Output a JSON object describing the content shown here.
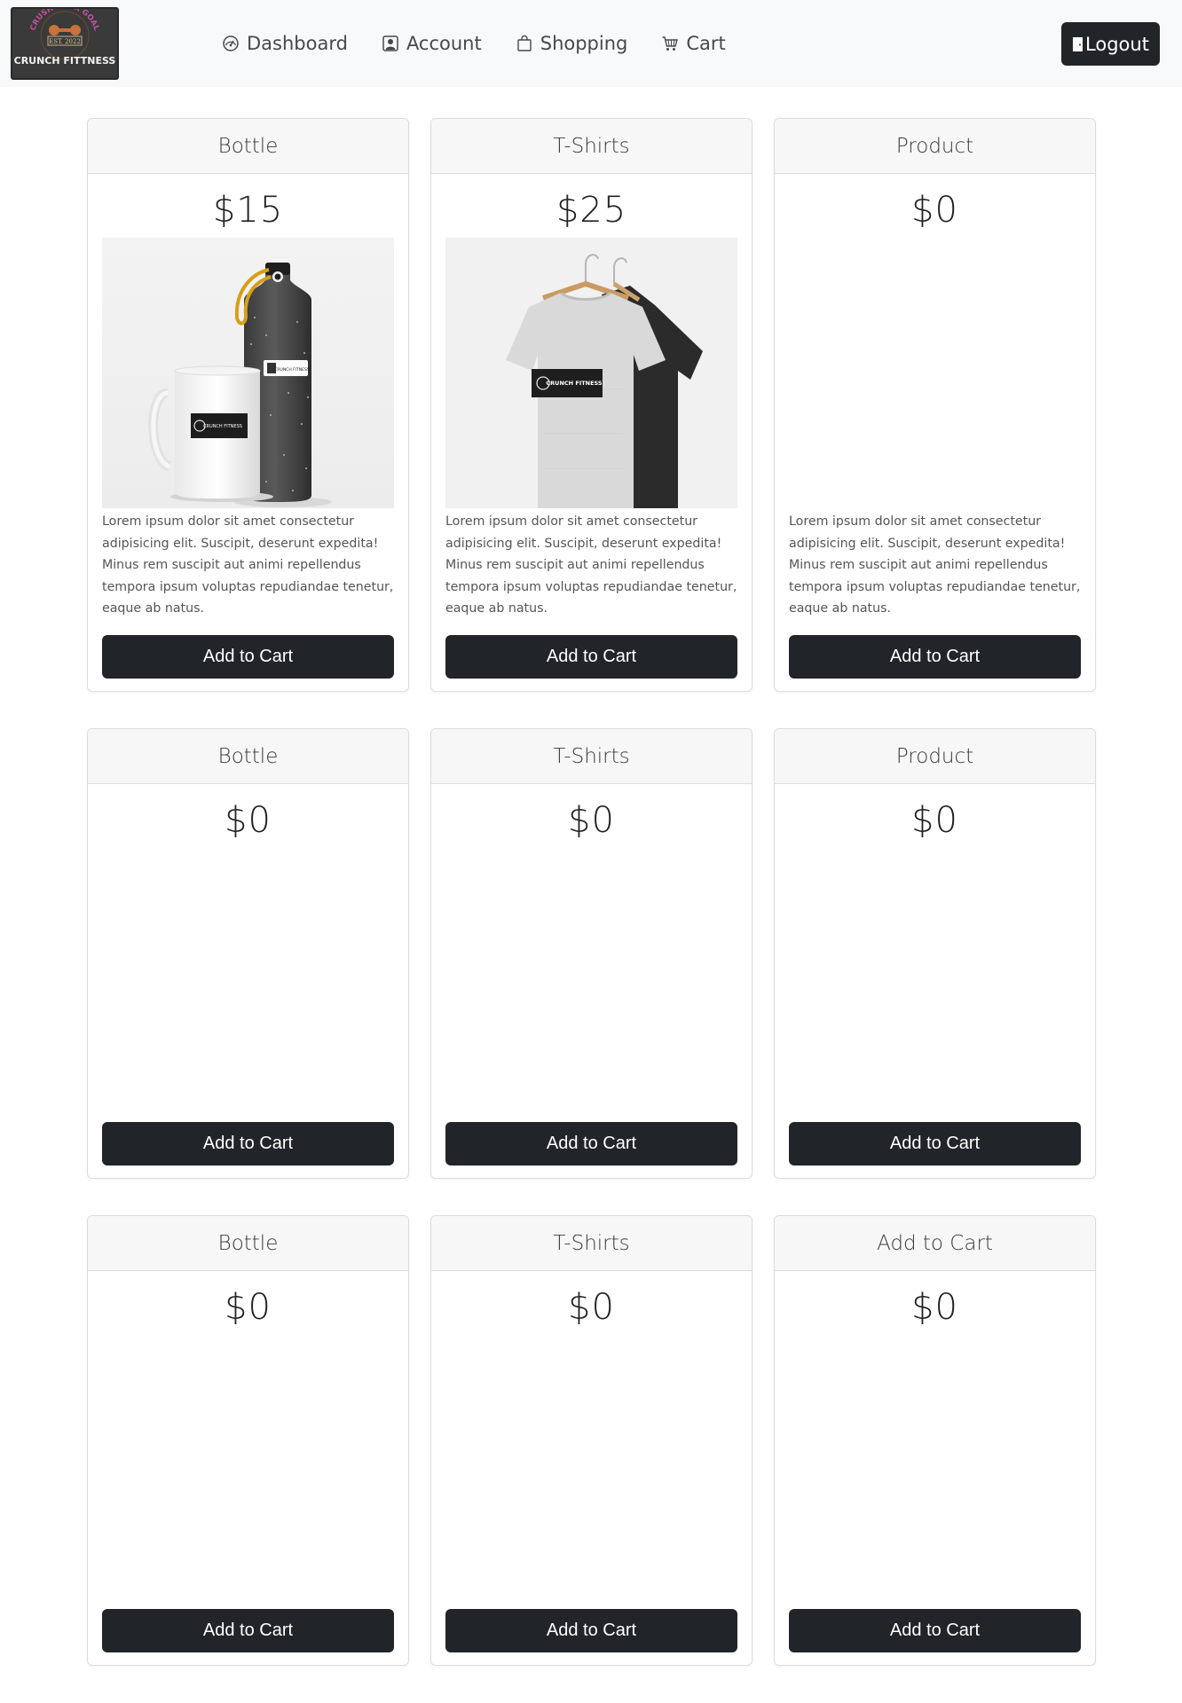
{
  "brand": {
    "logo_arc_text": "CRUSH YOUR GOAL",
    "logo_est_text": "EST. 2022",
    "logo_name": "CRUNCH FITTNESS"
  },
  "nav": {
    "items": [
      {
        "label": "Dashboard",
        "icon": "speedometer-icon"
      },
      {
        "label": "Account",
        "icon": "person-square-icon"
      },
      {
        "label": "Shopping",
        "icon": "bag-icon"
      },
      {
        "label": "Cart",
        "icon": "cart-icon"
      }
    ],
    "logout_label": "Logout"
  },
  "products": [
    {
      "title": "Bottle",
      "price": "$15",
      "image": "bottle-and-mug",
      "description": "Lorem ipsum dolor sit amet consectetur adipisicing elit. Suscipit, deserunt expedita! Minus rem suscipit aut animi repellendus tempora ipsum voluptas repudiandae tenetur, eaque ab natus.",
      "button": "Add to Cart"
    },
    {
      "title": "T-Shirts",
      "price": "$25",
      "image": "t-shirts-on-hangers",
      "description": "Lorem ipsum dolor sit amet consectetur adipisicing elit. Suscipit, deserunt expedita! Minus rem suscipit aut animi repellendus tempora ipsum voluptas repudiandae tenetur, eaque ab natus.",
      "button": "Add to Cart"
    },
    {
      "title": "Product",
      "price": "$0",
      "image": "",
      "description": "Lorem ipsum dolor sit amet consectetur adipisicing elit. Suscipit, deserunt expedita! Minus rem suscipit aut animi repellendus tempora ipsum voluptas repudiandae tenetur, eaque ab natus.",
      "button": "Add to Cart"
    },
    {
      "title": "Bottle",
      "price": "$0",
      "button": "Add to Cart"
    },
    {
      "title": "T-Shirts",
      "price": "$0",
      "button": "Add to Cart"
    },
    {
      "title": "Product",
      "price": "$0",
      "button": "Add to Cart"
    },
    {
      "title": "Bottle",
      "price": "$0",
      "button": "Add to Cart"
    },
    {
      "title": "T-Shirts",
      "price": "$0",
      "button": "Add to Cart"
    },
    {
      "title": "Add to Cart",
      "price": "$0",
      "button": "Add to Cart"
    }
  ],
  "mockup_label": "CRUNCH FITNESS"
}
